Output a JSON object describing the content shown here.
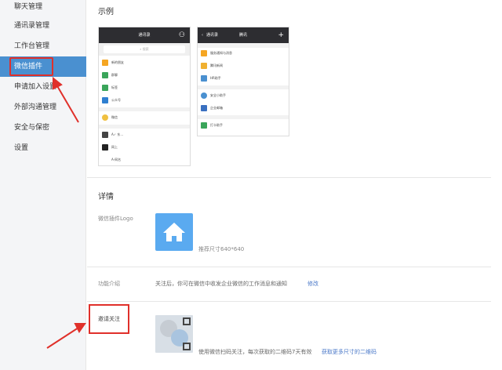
{
  "sidebar": {
    "items": [
      {
        "label": "聊天管理",
        "active": false
      },
      {
        "label": "通讯录管理",
        "active": false
      },
      {
        "label": "工作台管理",
        "active": false
      },
      {
        "label": "微信插件",
        "active": true
      },
      {
        "label": "申请加入设置",
        "active": false
      },
      {
        "label": "外部沟通管理",
        "active": false
      },
      {
        "label": "安全与保密",
        "active": false
      },
      {
        "label": "设置",
        "active": false
      }
    ]
  },
  "example": {
    "title": "示例",
    "phone1": {
      "title": "通讯录",
      "search": "搜索",
      "rows": [
        "新的朋友",
        "群聊",
        "标签",
        "公众号",
        "微信",
        "A✓ 东…",
        "网上",
        "A-网名"
      ]
    },
    "phone2": {
      "title": "腾讯",
      "back": "通讯录",
      "rows": [
        "服务通知与消息",
        "腾讯新闻",
        "HR助手",
        "安全小助手",
        "企业邮箱",
        "打卡助手"
      ]
    }
  },
  "details": {
    "title": "详情",
    "logo_label": "微信插件Logo",
    "logo_hint": "推荐尺寸640*640",
    "intro_label": "功能介绍",
    "intro_text": "关注后，你可在微信中收发企业微信的工作消息和通知",
    "intro_edit": "修改",
    "invite_label": "邀请关注",
    "invite_text": "使用微信扫码关注，每次获取的二维码7天有效",
    "invite_link": "获取更多尺寸的二维码"
  },
  "colors": {
    "active": "#4a90d0",
    "highlight": "#e0302a",
    "logo": "#5aaaf0",
    "link": "#4a78c8"
  },
  "icons": {
    "logo": "home-icon"
  }
}
